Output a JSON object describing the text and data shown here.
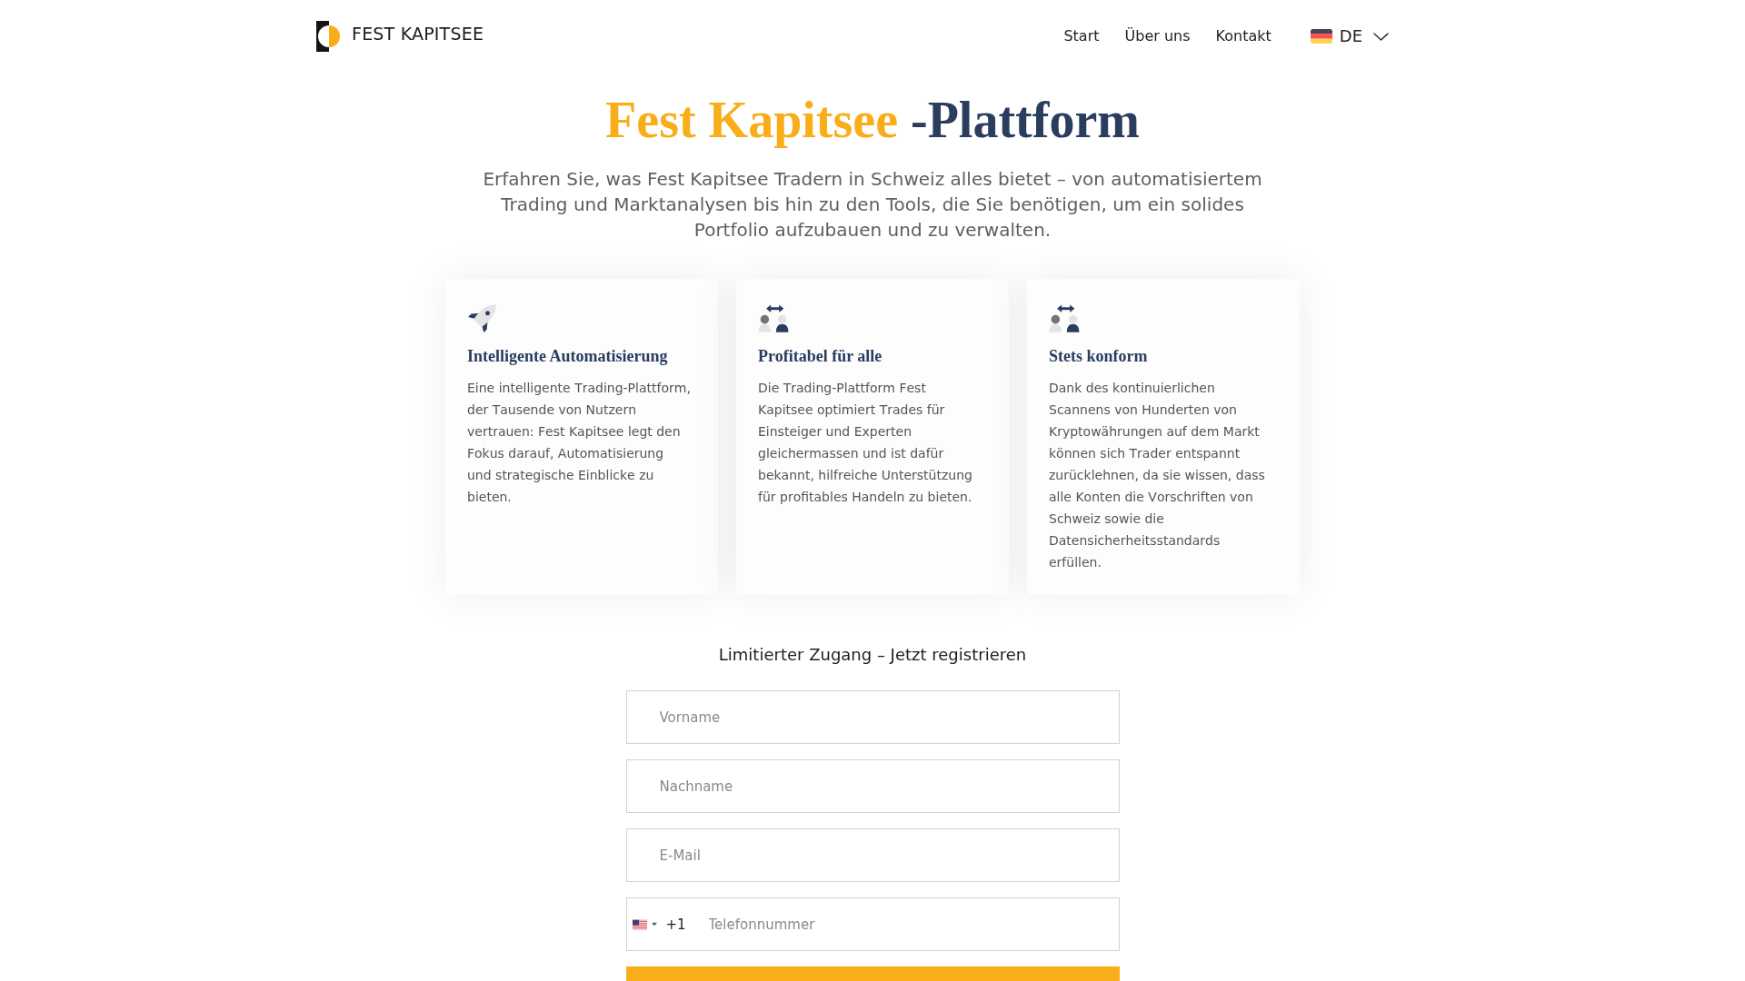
{
  "header": {
    "brand": "FEST KAPITSEE",
    "nav": [
      {
        "label": "Start"
      },
      {
        "label": "Über uns"
      },
      {
        "label": "Kontakt"
      }
    ],
    "language": {
      "code": "DE"
    }
  },
  "hero": {
    "title_highlight": "Fest Kapitsee",
    "title_rest": "-Plattform",
    "subtitle": "Erfahren Sie, was Fest Kapitsee Tradern in Schweiz alles bietet – von automatisiertem Trading und Marktanalysen bis hin zu den Tools, die Sie benötigen, um ein solides Portfolio aufzubauen und zu verwalten."
  },
  "features": [
    {
      "kind": "rocket",
      "title": "Intelligente Automatisierung",
      "text": "Eine intelligente Trading-Plattform, der Tausende von Nutzern vertrauen: Fest Kapitsee legt den Fokus darauf, Automatisierung und strategische Einblicke zu bieten."
    },
    {
      "kind": "exchange",
      "title": "Profitabel für alle",
      "text": "Die Trading-Plattform Fest Kapitsee optimiert Trades für Einsteiger und Experten gleichermassen und ist dafür bekannt, hilfreiche Unterstützung für profitables Handeln zu bieten."
    },
    {
      "kind": "exchange",
      "title": "Stets konform",
      "text": "Dank des kontinuierlichen Scannens von Hunderten von Kryptowährungen auf dem Markt können sich Trader entspannt zurücklehnen, da sie wissen, dass alle Konten die Vorschriften von Schweiz sowie die Datensicherheitsstandards erfüllen."
    }
  ],
  "form": {
    "heading": "Limitierter Zugang – Jetzt registrieren",
    "fields": [
      {
        "kind": "text",
        "placeholder": "Vorname"
      },
      {
        "kind": "text",
        "placeholder": "Nachname"
      },
      {
        "kind": "email",
        "placeholder": "E-Mail"
      },
      {
        "kind": "phone",
        "dial_code": "+1",
        "placeholder": "Telefonnummer"
      }
    ]
  }
}
